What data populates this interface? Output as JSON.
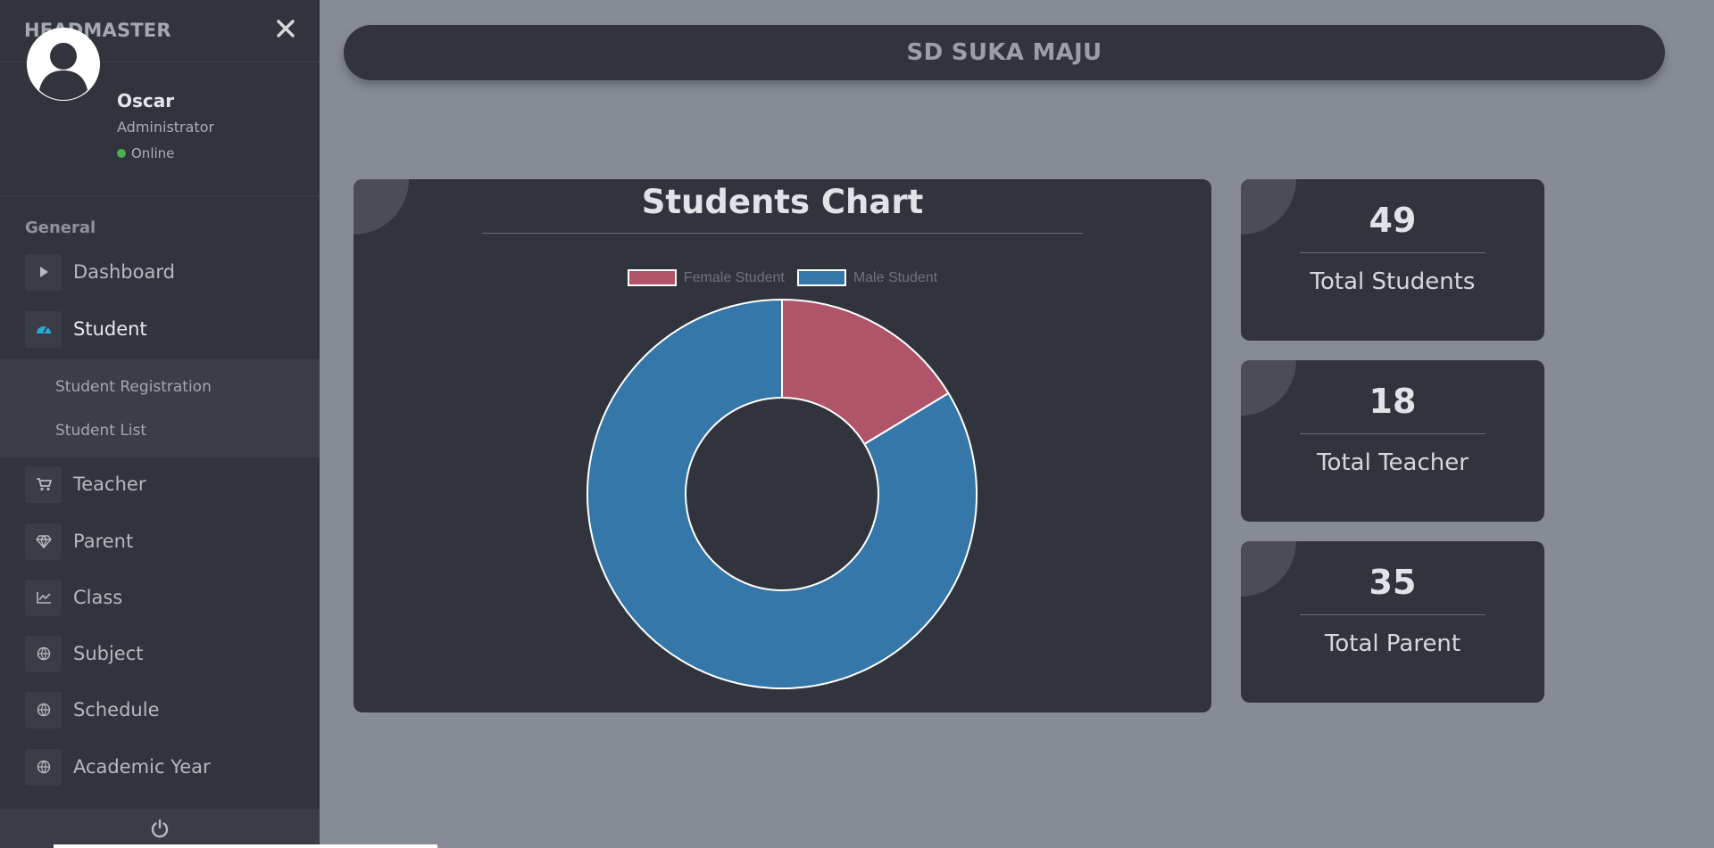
{
  "sidebar": {
    "brand": "HEADMASTER",
    "close_icon": "close-icon",
    "profile": {
      "name": "Oscar",
      "role": "Administrator",
      "status": "Online",
      "status_color": "#4caf50"
    },
    "section_title": "General",
    "items": [
      {
        "label": "Dashboard",
        "icon": "play-icon"
      },
      {
        "label": "Student",
        "icon": "gauge-icon",
        "active": true
      },
      {
        "label": "Teacher",
        "icon": "cart-icon"
      },
      {
        "label": "Parent",
        "icon": "diamond-icon"
      },
      {
        "label": "Class",
        "icon": "line-chart-icon"
      },
      {
        "label": "Subject",
        "icon": "globe-icon"
      },
      {
        "label": "Schedule",
        "icon": "globe-icon"
      },
      {
        "label": "Academic Year",
        "icon": "globe-icon"
      }
    ],
    "submenu": [
      {
        "label": "Student Registration"
      },
      {
        "label": "Student List"
      }
    ],
    "footer_icon": "power-icon"
  },
  "header": {
    "title": "SD SUKA MAJU"
  },
  "chart_card": {
    "title": "Students Chart"
  },
  "chart_data": {
    "type": "pie",
    "variant": "doughnut",
    "title": "Students Chart",
    "legend_position": "top",
    "categories": [
      "Female Student",
      "Male Student"
    ],
    "values": [
      8,
      41
    ],
    "colors": [
      "#b0546a",
      "#3577a8"
    ]
  },
  "stats": [
    {
      "value": "49",
      "label": "Total Students"
    },
    {
      "value": "18",
      "label": "Total Teacher"
    },
    {
      "value": "35",
      "label": "Total Parent"
    }
  ]
}
